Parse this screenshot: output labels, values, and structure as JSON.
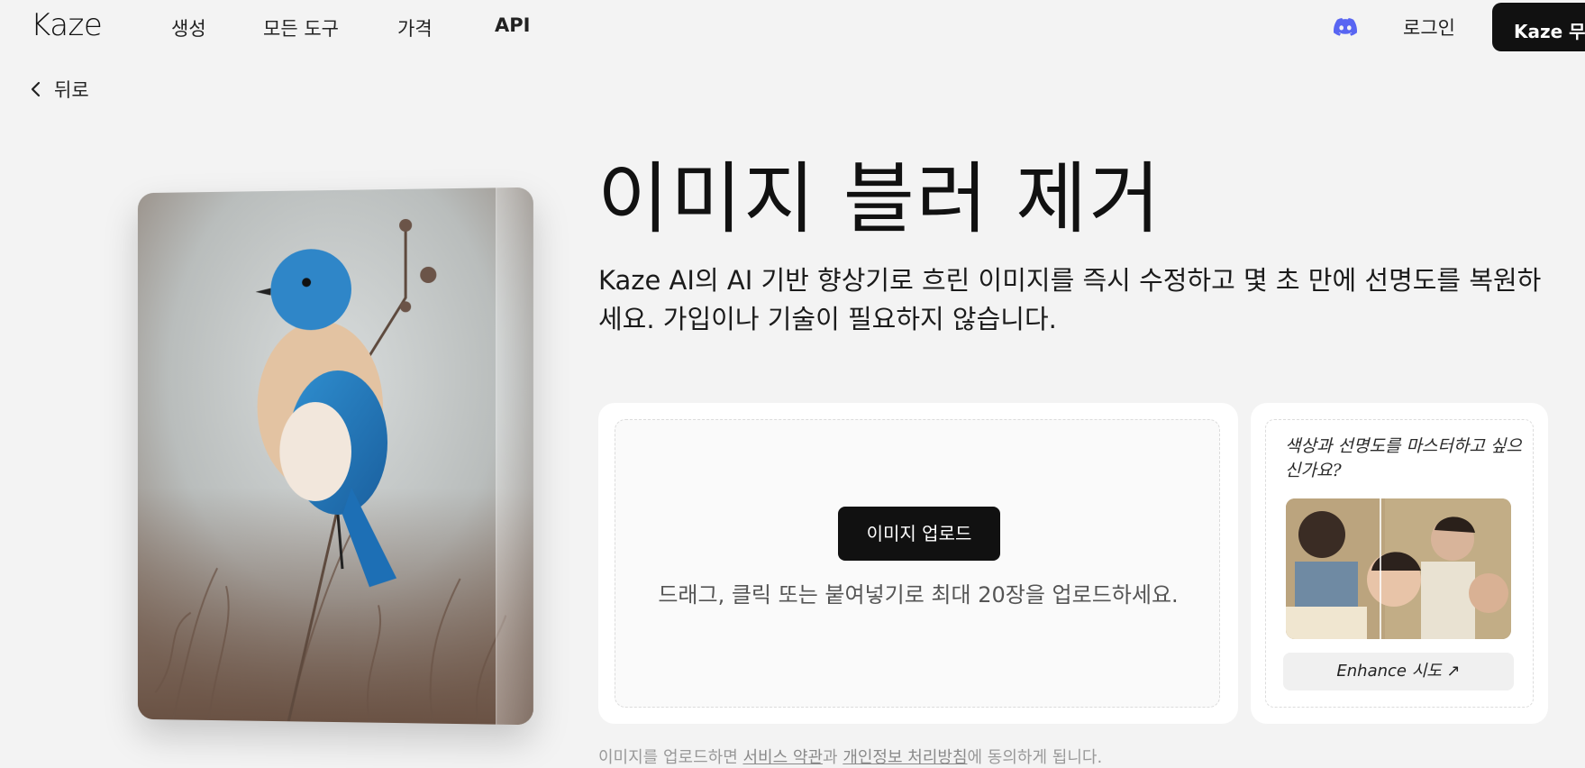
{
  "nav": {
    "logo": "Kaze",
    "items": [
      "생성",
      "모든 도구",
      "가격",
      "API"
    ],
    "login": "로그인",
    "cta": "Kaze 무료"
  },
  "back": {
    "label": "뒤로"
  },
  "hero": {
    "title": "이미지 블러 제거",
    "description": "Kaze AI의 AI 기반 향상기로 흐린 이미지를 즉시 수정하고 몇 초 만에 선명도를 복원하세요. 가입이나 기술이 필요하지 않습니다."
  },
  "upload": {
    "button": "이미지 업로드",
    "hint": "드래그, 클릭 또는 붙여넣기로 최대 20장을 업로드하세요."
  },
  "promo": {
    "text": "색상과 선명도를 마스터하고 싶으신가요?",
    "button": "Enhance 시도 ↗"
  },
  "legal": {
    "prefix": "이미지를 업로드하면 ",
    "terms": "서비스 약관",
    "and": "과 ",
    "privacy": "개인정보 처리방침",
    "suffix": "에 동의하게 됩니다."
  },
  "colors": {
    "accent": "#111111",
    "discord": "#5865F2",
    "background": "#f3f3f3"
  }
}
